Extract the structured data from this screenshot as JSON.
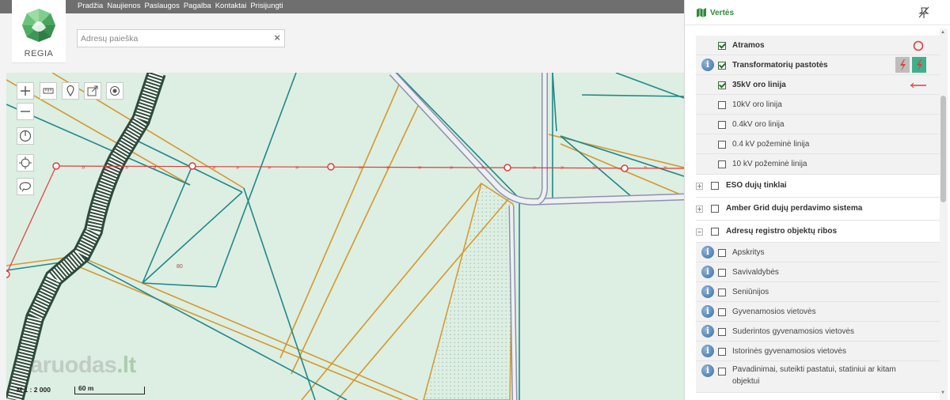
{
  "nav": {
    "items": [
      "Pradžia",
      "Naujienos",
      "Paslaugos",
      "Pagalba",
      "Kontaktai",
      "Prisijungti"
    ]
  },
  "logo": {
    "text": "REGIA"
  },
  "search": {
    "placeholder": "Adresų paieška",
    "value": "",
    "clear_icon": "×"
  },
  "map": {
    "parcel_number": "80",
    "scale_label": "M 1 : 2 000",
    "scale_bar_label": "60 m",
    "watermark_main": "aruodas",
    "watermark_tld": ".lt",
    "tools": [
      {
        "name": "zoom-in-icon"
      },
      {
        "name": "ruler-icon"
      },
      {
        "name": "pin-icon"
      },
      {
        "name": "share-icon"
      },
      {
        "name": "locate-icon"
      },
      {
        "name": "zoom-out-icon"
      },
      {
        "name": "power-icon"
      },
      {
        "name": "gps-target-icon"
      },
      {
        "name": "lasso-icon"
      }
    ],
    "colors": {
      "background": "#dcefe2",
      "parcel_teal": "#22868a",
      "parcel_orange": "#d6972e",
      "power_line_red": "#e03c3c",
      "road_gray": "#9da0b4",
      "railway": "#2e4a3a"
    }
  },
  "panel": {
    "title": "Vertės",
    "layers": [
      {
        "label": "Atramos",
        "checked": true,
        "bold": true,
        "info": false,
        "legend": "red-circle-icon"
      },
      {
        "label": "Transformatorių pastotės",
        "checked": true,
        "bold": true,
        "info": true,
        "legend": "substation-icon"
      },
      {
        "label": "35kV oro linija",
        "checked": true,
        "bold": true,
        "info": false,
        "legend": "red-arrow-line-icon"
      },
      {
        "label": "10kV oro linija",
        "checked": false,
        "bold": false,
        "info": false
      },
      {
        "label": "0.4kV oro linija",
        "checked": false,
        "bold": false,
        "info": false
      },
      {
        "label": "0.4 kV požeminė linija",
        "checked": false,
        "bold": false,
        "info": false
      },
      {
        "label": "10 kV požeminė linija",
        "checked": false,
        "bold": false,
        "info": false
      }
    ],
    "groups": [
      {
        "label": "ESO dujų tinklai",
        "expanded": false
      },
      {
        "label": "Amber Grid dujų perdavimo sistema",
        "expanded": false
      },
      {
        "label": "Adresų registro objektų ribos",
        "expanded": true
      }
    ],
    "address_layers": [
      {
        "label": "Apskritys"
      },
      {
        "label": "Savivaldybės"
      },
      {
        "label": "Seniūnijos"
      },
      {
        "label": "Gyvenamosios vietovės"
      },
      {
        "label": "Suderintos gyvenamosios vietovės"
      },
      {
        "label": "Istorinės gyvenamosios vietovės"
      },
      {
        "label": "Pavadinimai, suteikti pastatui, statiniui ar kitam",
        "label2": "objektui"
      }
    ]
  }
}
